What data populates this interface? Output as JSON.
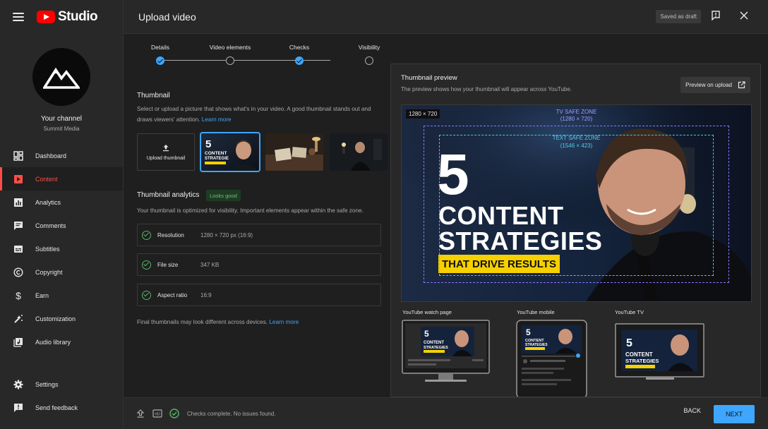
{
  "app": {
    "logo_text": "Studio"
  },
  "channel": {
    "name": "Your channel",
    "subtitle": "Summit Media"
  },
  "sidebar": {
    "items": [
      {
        "label": "Dashboard",
        "icon": "dashboard-icon"
      },
      {
        "label": "Content",
        "icon": "content-icon",
        "active": true
      },
      {
        "label": "Analytics",
        "icon": "analytics-icon"
      },
      {
        "label": "Comments",
        "icon": "comments-icon"
      },
      {
        "label": "Subtitles",
        "icon": "subtitles-icon"
      },
      {
        "label": "Copyright",
        "icon": "copyright-icon"
      },
      {
        "label": "Earn",
        "icon": "earn-icon"
      },
      {
        "label": "Customization",
        "icon": "customization-icon"
      },
      {
        "label": "Audio library",
        "icon": "audio-library-icon"
      }
    ],
    "bottom": [
      {
        "label": "Settings",
        "icon": "gear-icon"
      },
      {
        "label": "Send feedback",
        "icon": "feedback-icon"
      }
    ]
  },
  "header": {
    "title": "Upload video",
    "saved_label": "Saved as draft"
  },
  "steps": [
    {
      "label": "Details",
      "done": true
    },
    {
      "label": "Video elements",
      "done": false
    },
    {
      "label": "Checks",
      "done": true
    },
    {
      "label": "Visibility",
      "done": false
    }
  ],
  "thumbnail": {
    "title": "Thumbnail",
    "desc": "Select or upload a picture that shows what's in your video. A good thumbnail stands out and draws viewers' attention.",
    "learn_more": "Learn more",
    "upload_label": "Upload thumbnail"
  },
  "analytics": {
    "title": "Thumbnail analytics",
    "status": "Looks good",
    "desc": "Your thumbnail is optimized for visibility. Important elements appear within the safe zone.",
    "checks": [
      {
        "label": "Resolution",
        "value": "1280 × 720 px (16:9)"
      },
      {
        "label": "File size",
        "value": "347 KB"
      },
      {
        "label": "Aspect ratio",
        "value": "16:9"
      }
    ],
    "final_note": "Final thumbnails may look different across devices.",
    "final_link": "Learn more"
  },
  "preview": {
    "title": "Thumbnail preview",
    "desc": "The preview shows how your thumbnail will appear across YouTube.",
    "button": "Preview on upload",
    "resolution": "1280 × 720",
    "tv_zone_label": "TV SAFE ZONE",
    "tv_zone_size": "(1280 × 720)",
    "text_zone_label": "TEXT SAFE ZONE",
    "text_zone_size": "(1546 × 423)",
    "thumb_number": "5",
    "thumb_line1": "CONTENT",
    "thumb_line2": "STRATEGIES",
    "thumb_band": "THAT DRIVE RESULTS",
    "devices": [
      "YouTube watch page",
      "YouTube mobile",
      "YouTube TV"
    ]
  },
  "footer": {
    "status": "Checks complete. No issues found.",
    "back": "BACK",
    "next": "NEXT"
  },
  "colors": {
    "accent": "#3ea6ff",
    "active_nav": "#ff4e45",
    "good": "#55b468",
    "band": "#f7d000"
  }
}
